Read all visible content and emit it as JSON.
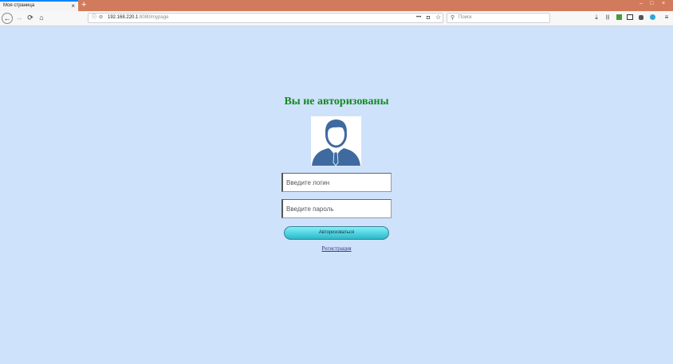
{
  "browser": {
    "tab_title": "Моя страница",
    "tab_close": "×",
    "new_tab": "+",
    "window_controls": {
      "minimize": "–",
      "maximize": "□",
      "close": "×"
    },
    "url_host": "192.168.220.1",
    "url_rest": ":8080/mypage",
    "search_placeholder": "Поиск",
    "nav": {
      "back": "←",
      "forward": "→",
      "reload": "⟳",
      "home": "⌂"
    },
    "toolbar_icons": {
      "page_actions": "•••",
      "pocket": "◘",
      "bookmark": "☆",
      "download": "⤓",
      "library": "|||",
      "menu": "≡"
    }
  },
  "page": {
    "heading": "Вы не авторизованы",
    "login_placeholder": "Введите логин",
    "password_placeholder": "Введите пароль",
    "login_button": "Авторизоваться",
    "register_link": "Регистрация"
  },
  "colors": {
    "background": "#cfe2fb",
    "heading": "#138a22",
    "avatar": "#3f6aa0",
    "titlebar": "#d27b5c"
  }
}
